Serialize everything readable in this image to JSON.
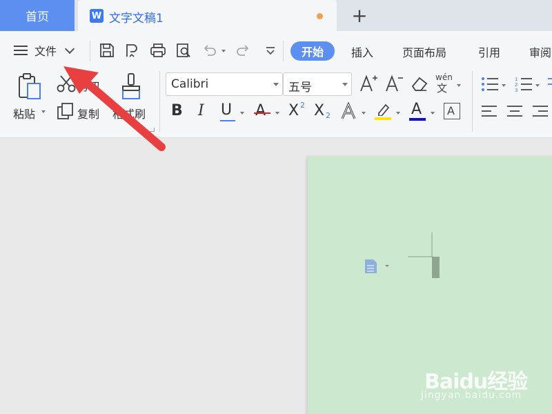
{
  "tabs": {
    "home": "首页",
    "document": "文字文稿1",
    "add_icon": "plus-icon"
  },
  "menu": {
    "file_label": "文件",
    "ribbon_tabs": [
      "开始",
      "插入",
      "页面布局",
      "引用",
      "审阅"
    ],
    "active_tab_index": 0
  },
  "clipboard": {
    "paste_label": "粘贴",
    "cut_label": "剪切",
    "copy_label": "复制",
    "format_painter_label": "格式刷"
  },
  "font": {
    "family": "Calibri",
    "size": "五号",
    "phonetic_label": "wén"
  },
  "colors": {
    "accent": "#5d8ff0",
    "doc_title": "#2f6fe8",
    "page_background": "#cce8cf",
    "annotation_arrow": "#e84040",
    "highlight_yellow": "#ffe600",
    "font_color_red": "#e02020",
    "font_color_blue": "#1010d0"
  },
  "watermark": {
    "logo": "Baidu经验",
    "url": "jingyan.baidu.com"
  }
}
